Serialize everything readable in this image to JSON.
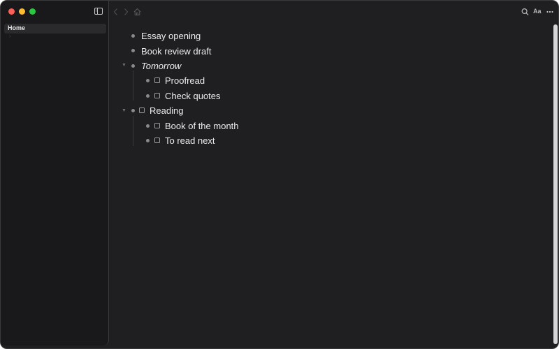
{
  "sidebar": {
    "items": [
      {
        "label": "Home",
        "selected": true
      }
    ]
  },
  "toolbar": {
    "icons": [
      "back-icon",
      "forward-icon",
      "home-icon",
      "search-icon",
      "font-size-icon",
      "more-icon"
    ],
    "font_size_label": "Aa"
  },
  "outline": {
    "items": [
      {
        "label": "Essay opening",
        "level": 0,
        "checkbox": false,
        "collapsible": false
      },
      {
        "label": "Book review draft",
        "level": 0,
        "checkbox": false,
        "collapsible": false
      },
      {
        "label": "Tomorrow",
        "level": 0,
        "checkbox": false,
        "collapsible": true,
        "italic": true,
        "children": [
          {
            "label": "Proofread",
            "checkbox": true,
            "checked": false
          },
          {
            "label": "Check quotes",
            "checkbox": true,
            "checked": false
          }
        ]
      },
      {
        "label": "Reading",
        "level": 0,
        "checkbox": true,
        "checked": false,
        "collapsible": true,
        "children": [
          {
            "label": "Book of the month",
            "checkbox": true,
            "checked": false
          },
          {
            "label": "To read next",
            "checkbox": true,
            "checked": false
          }
        ]
      }
    ]
  },
  "colors": {
    "background": "#1f1f21",
    "sidebar": "#19191b",
    "text": "#ededef",
    "close": "#ff5f57",
    "minimize": "#febc2e",
    "zoom": "#28c840"
  }
}
